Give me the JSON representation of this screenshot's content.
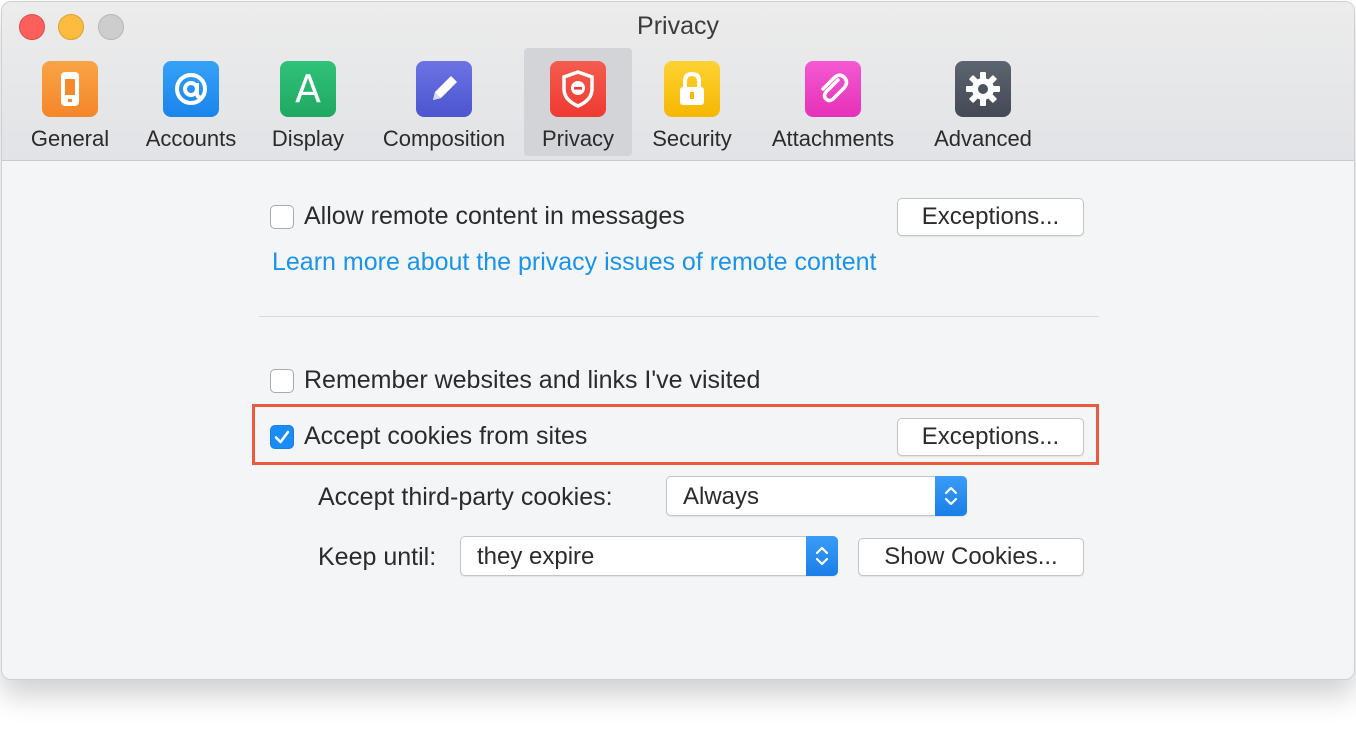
{
  "window": {
    "title": "Privacy"
  },
  "tabs": [
    {
      "label": "General",
      "icon": "phone-icon",
      "color": "#f7962f"
    },
    {
      "label": "Accounts",
      "icon": "at-sign-icon",
      "color": "#1e8ef0"
    },
    {
      "label": "Display",
      "icon": "letter-a-icon",
      "color": "#27b46c"
    },
    {
      "label": "Composition",
      "icon": "pencil-icon",
      "color": "#5b63d9"
    },
    {
      "label": "Privacy",
      "icon": "shield-icon",
      "color": "#f2463d",
      "active": true
    },
    {
      "label": "Security",
      "icon": "lock-icon",
      "color": "#f9c205"
    },
    {
      "label": "Attachments",
      "icon": "paperclip-icon",
      "color": "#ee3fc5"
    },
    {
      "label": "Advanced",
      "icon": "gear-icon",
      "color": "#4e5560"
    }
  ],
  "remote_content": {
    "checkbox_label": "Allow remote content in messages",
    "checked": false,
    "exceptions_label": "Exceptions...",
    "learn_more": "Learn more about the privacy issues of remote content"
  },
  "history": {
    "checkbox_label": "Remember websites and links I've visited",
    "checked": false
  },
  "cookies": {
    "checkbox_label": "Accept cookies from sites",
    "checked": true,
    "exceptions_label": "Exceptions...",
    "third_party_label": "Accept third-party cookies:",
    "third_party_value": "Always",
    "keep_until_label": "Keep until:",
    "keep_until_value": "they expire",
    "show_cookies_label": "Show Cookies..."
  },
  "colors": {
    "accent": "#1a8cf5",
    "link": "#1a94e8",
    "highlight": "#ea5a41"
  }
}
